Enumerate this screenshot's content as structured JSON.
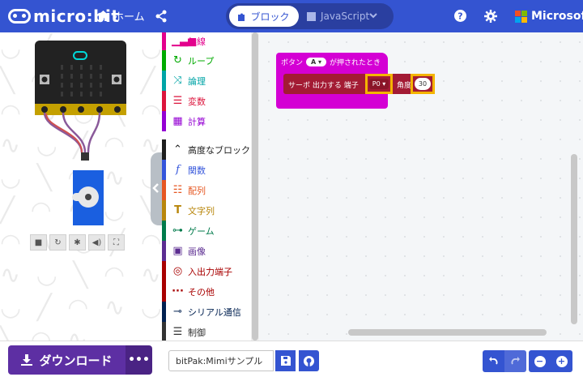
{
  "header": {
    "logo_text": "micro:bit",
    "home_label": "ホーム",
    "tab_blocks": "ブロック",
    "tab_javascript": "JavaScript",
    "brand": "Microsoft",
    "colors": {
      "header_bg": "#3454d1",
      "accent": "#3454d1"
    }
  },
  "toolbox": {
    "items": [
      {
        "label": "無線",
        "color": "#e3008c",
        "icon": "signal-bars-icon"
      },
      {
        "label": "ループ",
        "color": "#00aa00",
        "icon": "loop-arrow-icon"
      },
      {
        "label": "論理",
        "color": "#00a4a6",
        "icon": "shuffle-icon"
      },
      {
        "label": "変数",
        "color": "#dc143c",
        "icon": "lines-icon"
      },
      {
        "label": "計算",
        "color": "#9400d3",
        "icon": "calculator-icon"
      },
      {
        "label": "高度なブロック",
        "color": "#1e1e1e",
        "icon": "chevron-up-icon"
      },
      {
        "label": "関数",
        "color": "#3455db",
        "icon": "function-icon"
      },
      {
        "label": "配列",
        "color": "#e65722",
        "icon": "list-icon"
      },
      {
        "label": "文字列",
        "color": "#b8860b",
        "icon": "text-t-icon"
      },
      {
        "label": "ゲーム",
        "color": "#007a4b",
        "icon": "gamepad-icon"
      },
      {
        "label": "画像",
        "color": "#5c2d91",
        "icon": "image-icon"
      },
      {
        "label": "入出力端子",
        "color": "#a80000",
        "icon": "target-icon"
      },
      {
        "label": "その他",
        "color": "#a80000",
        "icon": "ellipsis-icon"
      },
      {
        "label": "シリアル通信",
        "color": "#002050",
        "icon": "usb-icon"
      },
      {
        "label": "制御",
        "color": "#333333",
        "icon": "server-icon"
      }
    ]
  },
  "workspace": {
    "event_block": {
      "prefix": "ボタン",
      "button": "A",
      "suffix": "が押されたとき",
      "color": "#d400d4"
    },
    "servo_block": {
      "label": "サーボ 出力する 端子",
      "pin": "P0",
      "angle_label": "角度",
      "angle": "30",
      "color": "#a31b34"
    }
  },
  "footer": {
    "download_label": "ダウンロード",
    "more_label": "•••",
    "project_name": "bitPak:Mimiサンプル",
    "zoom_out": "−",
    "zoom_in": "+"
  },
  "simulator": {
    "controls": [
      "stop-icon",
      "restart-icon",
      "debug-icon",
      "mute-icon",
      "fullscreen-icon"
    ]
  }
}
